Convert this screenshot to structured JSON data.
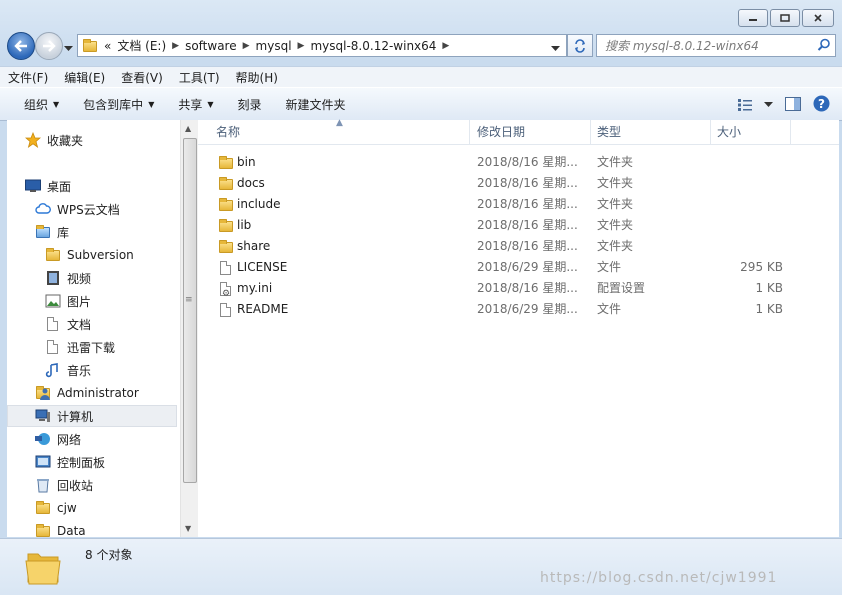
{
  "window": {
    "caption_buttons": [
      "minimize-icon",
      "maximize-icon",
      "close-icon"
    ]
  },
  "nav": {
    "breadcrumb_prefix": "«",
    "breadcrumbs": [
      "文档 (E:)",
      "software",
      "mysql",
      "mysql-8.0.12-winx64"
    ],
    "search_placeholder": "搜索 mysql-8.0.12-winx64"
  },
  "menu": [
    "文件(F)",
    "编辑(E)",
    "查看(V)",
    "工具(T)",
    "帮助(H)"
  ],
  "toolbar": {
    "organize": "组织",
    "include_library": "包含到库中",
    "share": "共享",
    "burn": "刻录",
    "new_folder": "新建文件夹"
  },
  "sidebar": {
    "items": [
      {
        "label": "收藏夹",
        "icon": "star-icon"
      },
      {
        "label": "桌面",
        "icon": "desktop-icon"
      },
      {
        "label": "WPS云文档",
        "icon": "cloud-icon"
      },
      {
        "label": "库",
        "icon": "library-icon"
      },
      {
        "label": "Subversion",
        "icon": "folder-icon"
      },
      {
        "label": "视频",
        "icon": "video-icon"
      },
      {
        "label": "图片",
        "icon": "picture-icon"
      },
      {
        "label": "文档",
        "icon": "document-icon"
      },
      {
        "label": "迅雷下载",
        "icon": "download-icon"
      },
      {
        "label": "音乐",
        "icon": "music-icon"
      },
      {
        "label": "Administrator",
        "icon": "user-icon"
      },
      {
        "label": "计算机",
        "icon": "computer-icon"
      },
      {
        "label": "网络",
        "icon": "network-icon"
      },
      {
        "label": "控制面板",
        "icon": "control-panel-icon"
      },
      {
        "label": "回收站",
        "icon": "recycle-bin-icon"
      },
      {
        "label": "cjw",
        "icon": "folder-icon"
      },
      {
        "label": "Data",
        "icon": "folder-icon"
      }
    ]
  },
  "columns": {
    "name": "名称",
    "modified": "修改日期",
    "type": "类型",
    "size": "大小"
  },
  "files": [
    {
      "name": "bin",
      "modified": "2018/8/16 星期...",
      "type": "文件夹",
      "size": "",
      "icon": "folder-icon"
    },
    {
      "name": "docs",
      "modified": "2018/8/16 星期...",
      "type": "文件夹",
      "size": "",
      "icon": "folder-icon"
    },
    {
      "name": "include",
      "modified": "2018/8/16 星期...",
      "type": "文件夹",
      "size": "",
      "icon": "folder-icon"
    },
    {
      "name": "lib",
      "modified": "2018/8/16 星期...",
      "type": "文件夹",
      "size": "",
      "icon": "folder-icon"
    },
    {
      "name": "share",
      "modified": "2018/8/16 星期...",
      "type": "文件夹",
      "size": "",
      "icon": "folder-icon"
    },
    {
      "name": "LICENSE",
      "modified": "2018/6/29 星期...",
      "type": "文件",
      "size": "295 KB",
      "icon": "file-icon"
    },
    {
      "name": "my.ini",
      "modified": "2018/8/16 星期...",
      "type": "配置设置",
      "size": "1 KB",
      "icon": "config-file-icon"
    },
    {
      "name": "README",
      "modified": "2018/6/29 星期...",
      "type": "文件",
      "size": "1 KB",
      "icon": "file-icon"
    }
  ],
  "status": {
    "count": "8 个对象",
    "watermark": "https://blog.csdn.net/cjw1991"
  },
  "colors": {
    "accent": "#2d68b9",
    "selection": "#eceff3",
    "folder": "#e6b73a"
  }
}
